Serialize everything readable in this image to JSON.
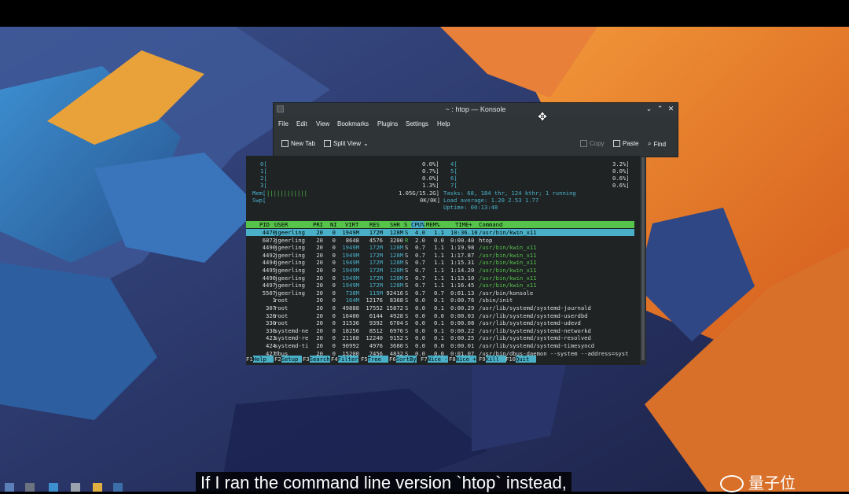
{
  "window": {
    "title": "~ : htop — Konsole",
    "controls": [
      "chevron-down-icon",
      "chevron-up-icon",
      "close-icon"
    ]
  },
  "menu": [
    "File",
    "Edit",
    "View",
    "Bookmarks",
    "Plugins",
    "Settings",
    "Help"
  ],
  "toolbar": {
    "new_tab": "New Tab",
    "split_view": "Split View",
    "copy": "Copy",
    "paste": "Paste",
    "find": "Find"
  },
  "htop": {
    "cpus": [
      {
        "id": "0[",
        "pct": "0.0%]"
      },
      {
        "id": "1[",
        "pct": "0.7%]"
      },
      {
        "id": "2[",
        "pct": "0.0%]"
      },
      {
        "id": "3[",
        "pct": "1.3%]"
      },
      {
        "id": "4[",
        "pct": "3.2%]"
      },
      {
        "id": "5[",
        "pct": "0.0%]"
      },
      {
        "id": "6[",
        "pct": "0.6%]"
      },
      {
        "id": "7[",
        "pct": "0.6%]"
      }
    ],
    "mem_label": "Mem[",
    "mem_bar": "||||||||||||",
    "mem_value": "1.05G/15.2G]",
    "swp_label": "Swp[",
    "swp_value": "0K/0K]",
    "tasks": "Tasks: 68, 184 thr, 124 kthr; 1 running",
    "load": "Load average: 1.20 2.53 1.77",
    "uptime": "Uptime: 00:13:48",
    "columns": [
      "PID",
      "USER",
      "PRI",
      "NI",
      "VIRT",
      "RES",
      "SHR",
      "S",
      "CPU%",
      "MEM%",
      "TIME+",
      "Command"
    ],
    "processes": [
      [
        "4470",
        "jgeerling",
        "20",
        "0",
        "1949M",
        "172M",
        "128M",
        "S",
        "4.0",
        "1.1",
        "10:36.10",
        "/usr/bin/kwin_x11"
      ],
      [
        "6873",
        "jgeerling",
        "20",
        "0",
        "8648",
        "4576",
        "3200",
        "R",
        "2.0",
        "0.0",
        "0:00.40",
        "htop"
      ],
      [
        "4490",
        "jgeerling",
        "20",
        "0",
        "1949M",
        "172M",
        "128M",
        "S",
        "0.7",
        "1.1",
        "1:19.98",
        "/usr/bin/kwin_x11"
      ],
      [
        "4492",
        "jgeerling",
        "20",
        "0",
        "1949M",
        "172M",
        "128M",
        "S",
        "0.7",
        "1.1",
        "1:17.87",
        "/usr/bin/kwin_x11"
      ],
      [
        "4494",
        "jgeerling",
        "20",
        "0",
        "1949M",
        "172M",
        "128M",
        "S",
        "0.7",
        "1.1",
        "1:15.31",
        "/usr/bin/kwin_x11"
      ],
      [
        "4495",
        "jgeerling",
        "20",
        "0",
        "1949M",
        "172M",
        "128M",
        "S",
        "0.7",
        "1.1",
        "1:14.20",
        "/usr/bin/kwin_x11"
      ],
      [
        "4496",
        "jgeerling",
        "20",
        "0",
        "1949M",
        "172M",
        "128M",
        "S",
        "0.7",
        "1.1",
        "1:13.10",
        "/usr/bin/kwin_x11"
      ],
      [
        "4497",
        "jgeerling",
        "20",
        "0",
        "1949M",
        "172M",
        "128M",
        "S",
        "0.7",
        "1.1",
        "1:16.45",
        "/usr/bin/kwin_x11"
      ],
      [
        "5507",
        "jgeerling",
        "20",
        "0",
        "738M",
        "115M",
        "92416",
        "S",
        "0.7",
        "0.7",
        "0:01.13",
        "/usr/bin/konsole"
      ],
      [
        "1",
        "root",
        "20",
        "0",
        "164M",
        "12176",
        "8368",
        "S",
        "0.0",
        "0.1",
        "0:00.76",
        "/sbin/init"
      ],
      [
        "307",
        "root",
        "20",
        "0",
        "49888",
        "17552",
        "15872",
        "S",
        "0.0",
        "0.1",
        "0:00.29",
        "/usr/lib/systemd/systemd-journald"
      ],
      [
        "326",
        "root",
        "20",
        "0",
        "16400",
        "6144",
        "4928",
        "S",
        "0.0",
        "0.0",
        "0:00.03",
        "/usr/lib/systemd/systemd-userdbd"
      ],
      [
        "330",
        "root",
        "20",
        "0",
        "31536",
        "9392",
        "6704",
        "S",
        "0.0",
        "0.1",
        "0:00.08",
        "/usr/lib/systemd/systemd-udevd"
      ],
      [
        "336",
        "systemd-ne",
        "20",
        "0",
        "18256",
        "8512",
        "6976",
        "S",
        "0.0",
        "0.1",
        "0:00.22",
        "/usr/lib/systemd/systemd-networkd"
      ],
      [
        "423",
        "systemd-re",
        "20",
        "0",
        "21168",
        "12240",
        "9152",
        "S",
        "0.0",
        "0.1",
        "0:00.25",
        "/usr/lib/systemd/systemd-resolved"
      ],
      [
        "424",
        "systemd-ti",
        "20",
        "0",
        "90992",
        "4976",
        "3680",
        "S",
        "0.0",
        "0.0",
        "0:00.01",
        "/usr/lib/systemd/systemd-timesyncd"
      ],
      [
        "427",
        "dbus",
        "20",
        "0",
        "15200",
        "7456",
        "4832",
        "S",
        "0.0",
        "0.0",
        "0:01.07",
        "/usr/bin/dbus-daemon --system --address=syst"
      ]
    ],
    "fkeys": [
      {
        "n": "F1",
        "l": "Help  "
      },
      {
        "n": "F2",
        "l": "Setup "
      },
      {
        "n": "F3",
        "l": "Search"
      },
      {
        "n": "F4",
        "l": "Filter"
      },
      {
        "n": "F5",
        "l": "Tree  "
      },
      {
        "n": "F6",
        "l": "SortBy"
      },
      {
        "n": "F7",
        "l": "Nice -"
      },
      {
        "n": "F8",
        "l": "Nice +"
      },
      {
        "n": "F9",
        "l": "Kill  "
      },
      {
        "n": "F10",
        "l": "Quit  "
      }
    ]
  },
  "subtitle": "If I ran the command line version `htop` instead,",
  "watermark": "量子位"
}
